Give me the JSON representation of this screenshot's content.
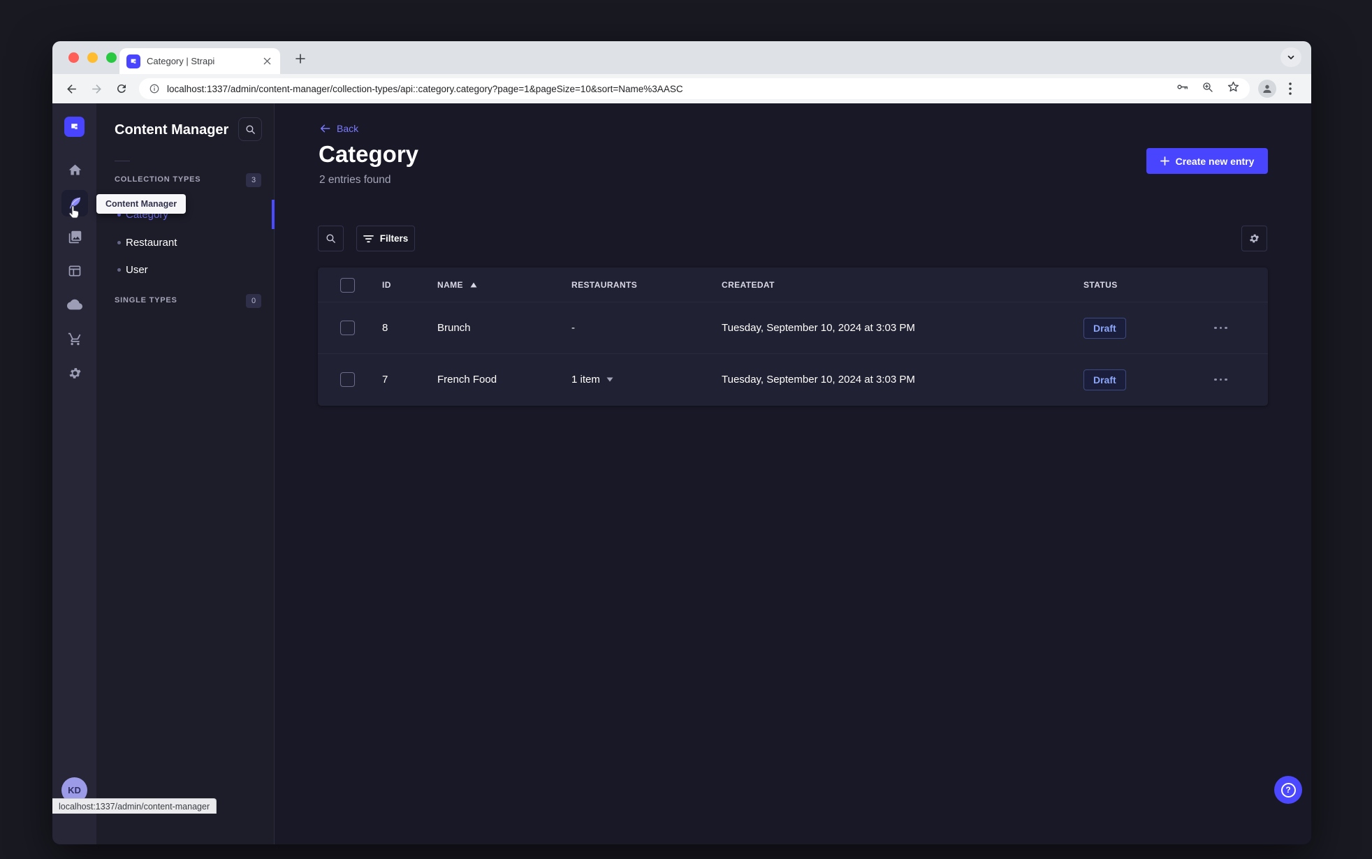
{
  "browser": {
    "tab_title": "Category | Strapi",
    "url": "localhost:1337/admin/content-manager/collection-types/api::category.category?page=1&pageSize=10&sort=Name%3AASC",
    "status_bar_text": "localhost:1337/admin/content-manager"
  },
  "rail": {
    "tooltip": "Content Manager",
    "avatar_initials": "KD",
    "icons": [
      "strapi-logo",
      "home",
      "content-manager",
      "media-library",
      "content-type-builder",
      "cloud",
      "marketplace",
      "settings"
    ]
  },
  "nav": {
    "title": "Content Manager",
    "collection_types": {
      "label": "COLLECTION TYPES",
      "count": "3",
      "items": [
        {
          "label": "Category",
          "active": true
        },
        {
          "label": "Restaurant",
          "active": false
        },
        {
          "label": "User",
          "active": false
        }
      ]
    },
    "single_types": {
      "label": "SINGLE TYPES",
      "count": "0"
    }
  },
  "main": {
    "back_label": "Back",
    "title": "Category",
    "subtitle": "2 entries found",
    "create_button_label": "Create new entry",
    "filters_button_label": "Filters",
    "table": {
      "headers": {
        "id": "ID",
        "name": "NAME",
        "restaurants": "RESTAURANTS",
        "created_at": "CREATEDAT",
        "status": "STATUS"
      },
      "sort": {
        "column": "NAME",
        "direction": "ascending"
      },
      "rows": [
        {
          "id": "8",
          "name": "Brunch",
          "restaurants": "-",
          "created_at": "Tuesday, September 10, 2024 at 3:03 PM",
          "status": "Draft"
        },
        {
          "id": "7",
          "name": "French Food",
          "restaurants": "1 item",
          "created_at": "Tuesday, September 10, 2024 at 3:03 PM",
          "status": "Draft"
        }
      ]
    }
  },
  "colors": {
    "primary": "#4945ff",
    "primary_light": "#7b79ff",
    "page_background": "#181826",
    "card_background": "#212134",
    "draft_text": "#8ba5f9"
  }
}
